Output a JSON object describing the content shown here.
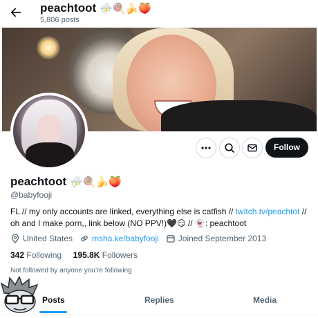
{
  "header": {
    "display_name": "peachtoot",
    "name_emojis": "⛈️🍭🍌🍑",
    "post_count": "5,806 posts"
  },
  "profile": {
    "display_name": "peachtoot",
    "name_emojis": "⛈️🍭🍌🍑",
    "handle": "@babyfooji",
    "bio_before_link": "FL // my only accounts are linked, everything else is catfish // ",
    "bio_link": "twitch.tv/peachtot",
    "bio_after_link": " // oh and I make porn,, link below (NO PPV!)🖤😏 // 👻: peachtoot",
    "location": "United States",
    "website": "msha.ke/babyfooji",
    "joined": "Joined September 2013",
    "following_count": "342",
    "following_label": "Following",
    "followers_count": "195.8K",
    "followers_label": "Followers",
    "not_followed_text": "Not followed by anyone you’re following"
  },
  "actions": {
    "follow_label": "Follow"
  },
  "tabs": [
    {
      "label": "Posts",
      "active": true
    },
    {
      "label": "Replies",
      "active": false
    },
    {
      "label": "Media",
      "active": false
    }
  ],
  "colors": {
    "accent": "#1d9bf0",
    "text_primary": "#0f1419",
    "text_secondary": "#536471",
    "follow_bg": "#0f1419"
  },
  "icons": [
    "back-arrow-icon",
    "more-icon",
    "search-icon",
    "message-icon",
    "location-icon",
    "link-icon",
    "calendar-icon"
  ]
}
